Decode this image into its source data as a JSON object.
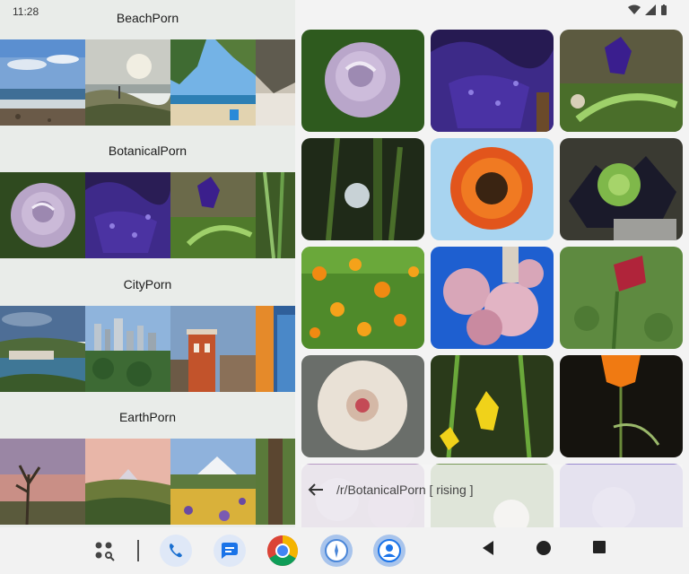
{
  "status": {
    "time": "11:28"
  },
  "sections": [
    {
      "title": "BeachPorn"
    },
    {
      "title": "BotanicalPorn"
    },
    {
      "title": "CityPorn"
    },
    {
      "title": "EarthPorn"
    }
  ],
  "search": {
    "text": "/r/BotanicalPorn [ rising ]"
  },
  "nav_icons": [
    "app-drawer-icon",
    "phone-icon",
    "messages-icon",
    "chrome-icon",
    "compass-icon",
    "account-icon"
  ],
  "colors": {
    "left_bg": "#e9ece9",
    "right_bg": "#f3f3f3",
    "accent": "#1a73e8"
  }
}
